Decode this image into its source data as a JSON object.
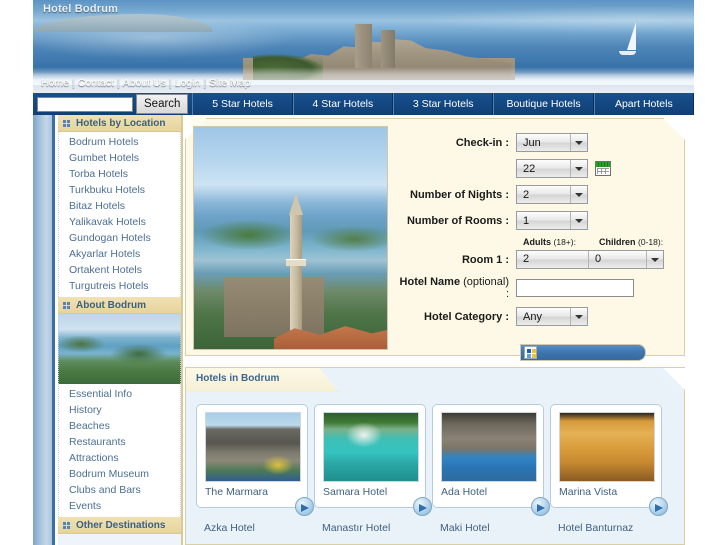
{
  "site": {
    "logo_text": "Hotel Bodrum"
  },
  "topnav": {
    "items": [
      "Home",
      "Contact",
      "About Us",
      "Login",
      "Site Map"
    ],
    "separator": "|"
  },
  "search": {
    "value": "",
    "placeholder": "",
    "button_label": "Search"
  },
  "tabs": [
    {
      "label": "5 Star Hotels"
    },
    {
      "label": "4 Star Hotels"
    },
    {
      "label": "3 Star Hotels"
    },
    {
      "label": "Boutique Hotels"
    },
    {
      "label": "Apart Hotels"
    }
  ],
  "sidebar": {
    "sections": [
      {
        "title": "Hotels by Location",
        "items": [
          "Bodrum Hotels",
          "Gumbet Hotels",
          "Torba Hotels",
          "Turkbuku Hotels",
          "Bitaz Hotels",
          "Yalikavak Hotels",
          "Gundogan Hotels",
          "Akyarlar Hotels",
          "Ortakent Hotels",
          "Turgutreis Hotels"
        ]
      },
      {
        "title": "About Bodrum",
        "items": [
          "Essential Info",
          "History",
          "Beaches",
          "Restaurants",
          "Attractions",
          "Bodrum Museum",
          "Clubs and Bars",
          "Events"
        ]
      },
      {
        "title": "Other Destinations",
        "items": []
      }
    ]
  },
  "booking_form": {
    "checkin_label": "Check-in :",
    "checkin_month": "Jun",
    "checkin_day": "22",
    "calendar_icon": "calendar-icon",
    "nights_label": "Number of Nights :",
    "nights_value": "2",
    "rooms_label": "Number of Rooms :",
    "rooms_value": "1",
    "adults_header": "Adults",
    "adults_header_note": "(18+):",
    "children_header": "Children",
    "children_header_note": "(0-18):",
    "room1_label": "Room 1 :",
    "room1_adults": "2",
    "room1_children": "0",
    "hotel_name_label": "Hotel Name",
    "hotel_name_optional": "(optional) :",
    "hotel_name_value": "",
    "category_label": "Hotel Category :",
    "category_value": "Any"
  },
  "hotels_section": {
    "tab_label": "Hotels in Bodrum",
    "cards": [
      {
        "name": "The Marmara",
        "thumb": "th-marmara",
        "below": "Azka Hotel"
      },
      {
        "name": "Samara Hotel",
        "thumb": "th-samara",
        "below": "Manastır Hotel"
      },
      {
        "name": "Ada Hotel",
        "thumb": "th-ada",
        "below": "Maki Hotel"
      },
      {
        "name": "Marina Vista",
        "thumb": "th-marina",
        "below": "Hotel Banturnaz"
      }
    ]
  },
  "colors": {
    "header_blue": "#113f74",
    "tab_blue": "#16508f",
    "panel_cream": "#fdf9e6",
    "panel_border": "#d8cfa5",
    "sidebar_head": "#e7d49c",
    "link_blue": "#4c6f93",
    "hotels_panel_bg": "#eaf2f9"
  }
}
